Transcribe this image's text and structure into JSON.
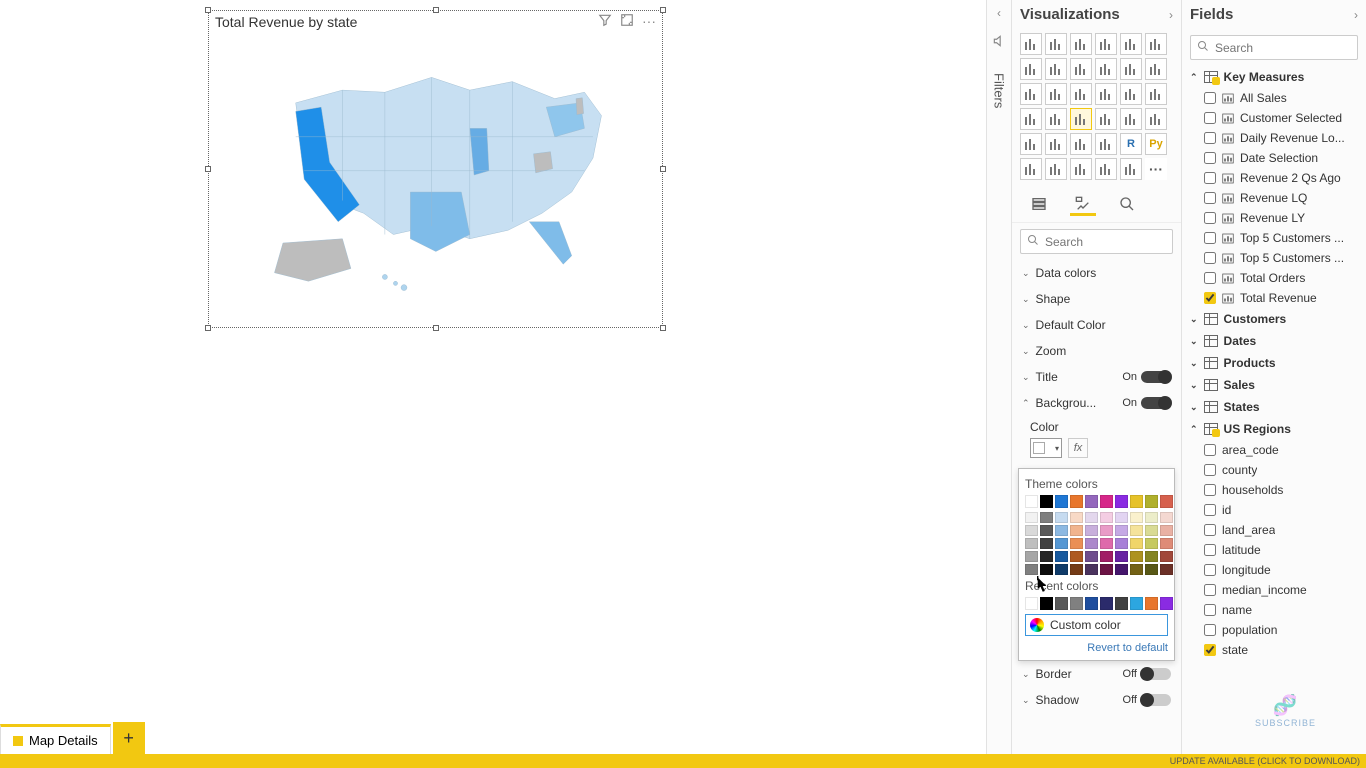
{
  "canvas": {
    "visual_title": "Total Revenue by state",
    "header_icons": {
      "filter": "filter-icon",
      "focus": "focus-mode-icon",
      "more": "more-options-icon"
    }
  },
  "tabs": {
    "active": "Map Details",
    "add_tooltip": "New page"
  },
  "status_bar": "UPDATE AVAILABLE (CLICK TO DOWNLOAD)",
  "filters_pane": {
    "label": "Filters"
  },
  "viz_pane": {
    "title": "Visualizations",
    "search_placeholder": "Search",
    "gallery": [
      "stacked-bar",
      "stacked-column",
      "clustered-bar",
      "clustered-column",
      "hundred-stacked-bar",
      "hundred-stacked-column",
      "line",
      "area",
      "stacked-area",
      "line-stacked-column",
      "line-clustered-column",
      "ribbon",
      "waterfall",
      "funnel",
      "scatter",
      "pie",
      "donut",
      "treemap",
      "map",
      "filled-map",
      "shape-map",
      "gauge",
      "card",
      "multi-row-card",
      "kpi",
      "slicer",
      "table",
      "matrix",
      "r-visual",
      "python-visual",
      "key-influencers",
      "decomposition-tree",
      "qna",
      "paginated",
      "arcgis",
      "more-visuals"
    ],
    "gallery_text": {
      "r-visual": "R",
      "python-visual": "Py",
      "more-visuals": "···"
    },
    "selected_visual": "shape-map",
    "tools": {
      "fields": "Fields",
      "format": "Format",
      "analytics": "Analytics"
    },
    "format_sections": {
      "data_colors": "Data colors",
      "shape": "Shape",
      "default_color": "Default Color",
      "zoom": "Zoom",
      "title": {
        "label": "Title",
        "state": "On"
      },
      "background": {
        "label": "Backgrou...",
        "state": "On"
      },
      "color_label": "Color",
      "border": {
        "label": "Border",
        "state": "Off"
      },
      "shadow": {
        "label": "Shadow",
        "state": "Off"
      }
    },
    "color_picker": {
      "theme_label": "Theme colors",
      "theme_row": [
        "#ffffff",
        "#000000",
        "#1f77d4",
        "#e8762c",
        "#9467bd",
        "#d62789",
        "#8a2be2",
        "#e6c229",
        "#b0b02c",
        "#d6604d"
      ],
      "shade_rows": [
        [
          "#f2f2f2",
          "#7f7f7f",
          "#c6dbf0",
          "#f8d9c6",
          "#e3d7ed",
          "#f4cde3",
          "#e2d4f2",
          "#faf1cd",
          "#ecedc9",
          "#f4d8d1"
        ],
        [
          "#d9d9d9",
          "#595959",
          "#8db9e2",
          "#f1b48e",
          "#c8afdc",
          "#e99bc7",
          "#c5a9e5",
          "#f5e39b",
          "#d9db94",
          "#e9b1a4"
        ],
        [
          "#bfbfbf",
          "#404040",
          "#5597d3",
          "#ea8f56",
          "#ac88cb",
          "#de69ab",
          "#a87fd8",
          "#f0d569",
          "#c6c95f",
          "#de8b77"
        ],
        [
          "#a6a6a6",
          "#262626",
          "#17599e",
          "#ae5921",
          "#6f4d8d",
          "#a11d66",
          "#6821a2",
          "#ad921f",
          "#848421",
          "#a1483a"
        ],
        [
          "#808080",
          "#0d0d0d",
          "#0f3b69",
          "#743b16",
          "#4a335e",
          "#6b1344",
          "#45166c",
          "#736115",
          "#585816",
          "#6b3027"
        ]
      ],
      "recent_label": "Recent colors",
      "recent_row": [
        "#ffffff",
        "#000000",
        "#595959",
        "#808080",
        "#1f4e9e",
        "#2b2b6b",
        "#404040",
        "#2ca6e0",
        "#e8762c",
        "#8a2be2"
      ],
      "custom_label": "Custom color",
      "revert_label": "Revert to default"
    }
  },
  "fields_pane": {
    "title": "Fields",
    "search_placeholder": "Search",
    "tables": [
      {
        "name": "Key Measures",
        "icon": "measure-table",
        "expanded": true,
        "fields": [
          {
            "name": "All Sales",
            "checked": false,
            "type": "measure"
          },
          {
            "name": "Customer Selected",
            "checked": false,
            "type": "measure"
          },
          {
            "name": "Daily Revenue Lo...",
            "checked": false,
            "type": "measure"
          },
          {
            "name": "Date Selection",
            "checked": false,
            "type": "measure"
          },
          {
            "name": "Revenue 2 Qs Ago",
            "checked": false,
            "type": "measure"
          },
          {
            "name": "Revenue LQ",
            "checked": false,
            "type": "measure"
          },
          {
            "name": "Revenue LY",
            "checked": false,
            "type": "measure"
          },
          {
            "name": "Top 5 Customers ...",
            "checked": false,
            "type": "measure"
          },
          {
            "name": "Top 5 Customers ...",
            "checked": false,
            "type": "measure"
          },
          {
            "name": "Total Orders",
            "checked": false,
            "type": "measure"
          },
          {
            "name": "Total Revenue",
            "checked": true,
            "type": "measure"
          }
        ]
      },
      {
        "name": "Customers",
        "icon": "table",
        "expanded": false
      },
      {
        "name": "Dates",
        "icon": "table",
        "expanded": false
      },
      {
        "name": "Products",
        "icon": "table",
        "expanded": false
      },
      {
        "name": "Sales",
        "icon": "table",
        "expanded": false
      },
      {
        "name": "States",
        "icon": "table",
        "expanded": false
      },
      {
        "name": "US Regions",
        "icon": "table-badge",
        "expanded": true,
        "fields": [
          {
            "name": "area_code",
            "checked": false,
            "type": "column"
          },
          {
            "name": "county",
            "checked": false,
            "type": "column"
          },
          {
            "name": "households",
            "checked": false,
            "type": "column"
          },
          {
            "name": "id",
            "checked": false,
            "type": "column"
          },
          {
            "name": "land_area",
            "checked": false,
            "type": "column"
          },
          {
            "name": "latitude",
            "checked": false,
            "type": "column"
          },
          {
            "name": "longitude",
            "checked": false,
            "type": "column"
          },
          {
            "name": "median_income",
            "checked": false,
            "type": "column"
          },
          {
            "name": "name",
            "checked": false,
            "type": "column"
          },
          {
            "name": "population",
            "checked": false,
            "type": "column"
          },
          {
            "name": "state",
            "checked": true,
            "type": "column"
          }
        ]
      }
    ]
  },
  "watermark": "SUBSCRIBE"
}
